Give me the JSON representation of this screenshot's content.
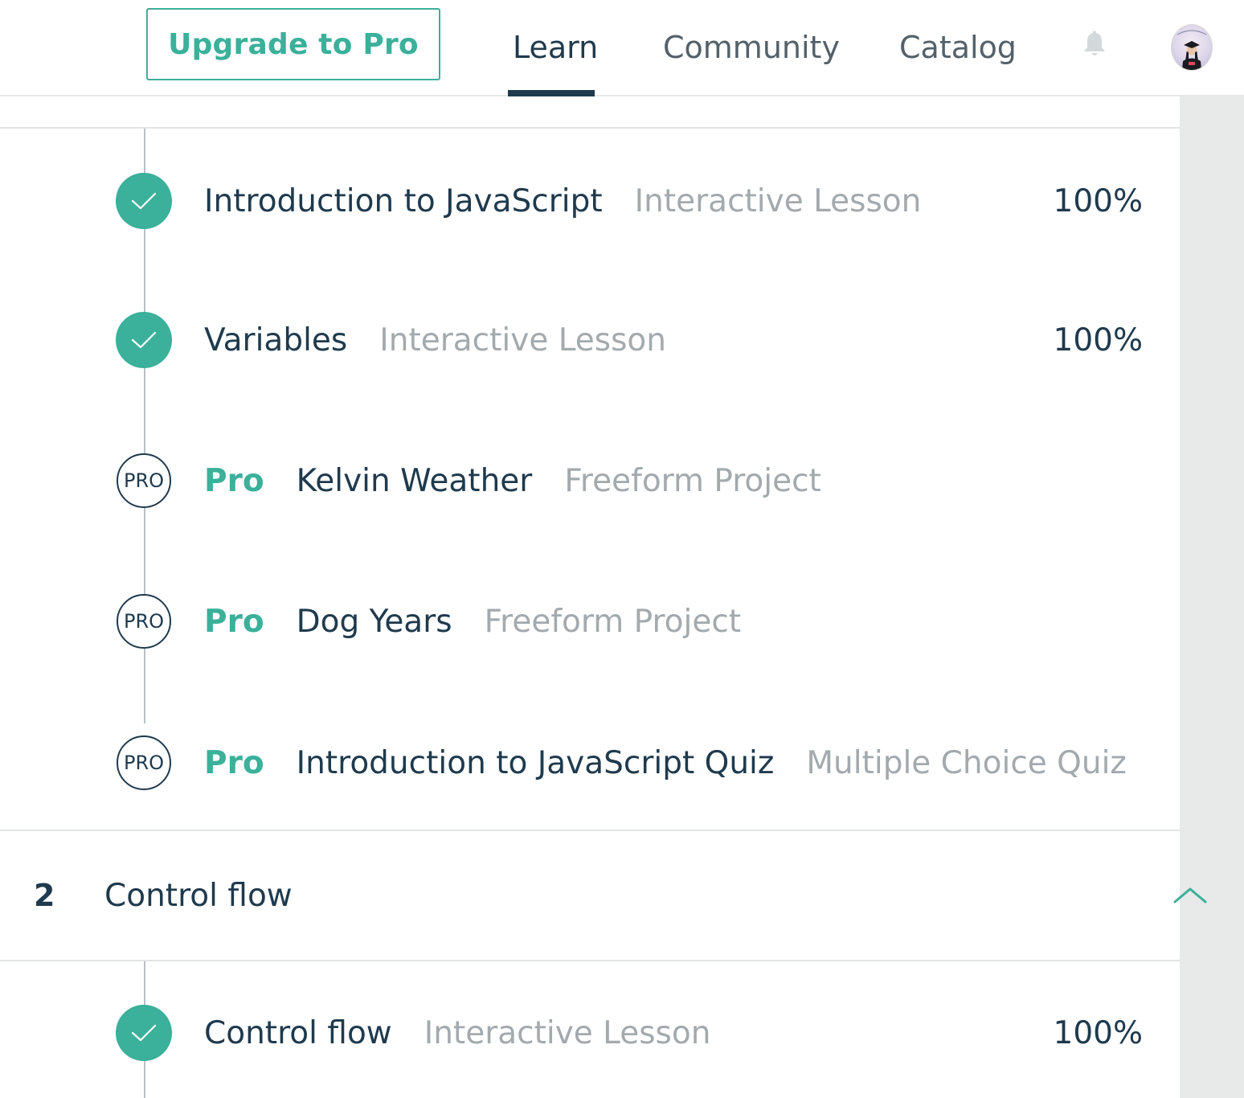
{
  "header": {
    "upgrade_label": "Upgrade to Pro",
    "nav": [
      {
        "label": "Learn",
        "active": true
      },
      {
        "label": "Community",
        "active": false
      },
      {
        "label": "Catalog",
        "active": false
      }
    ],
    "bell_icon": "bell-icon",
    "avatar_icon": "user-avatar"
  },
  "colors": {
    "accent": "#3bb09a",
    "text_dark": "#1f3a4d",
    "text_muted": "#a3aaae",
    "divider": "#e2e5e5",
    "scroll_track": "#e8e9e9"
  },
  "section1": {
    "items": [
      {
        "status": "complete",
        "status_icon": "check-icon",
        "title": "Introduction to JavaScript",
        "type": "Interactive Lesson",
        "progress": "100%"
      },
      {
        "status": "complete",
        "status_icon": "check-icon",
        "title": "Variables",
        "type": "Interactive Lesson",
        "progress": "100%"
      },
      {
        "status": "pro",
        "badge": "PRO",
        "pro_label": "Pro",
        "title": "Kelvin Weather",
        "type": "Freeform Project"
      },
      {
        "status": "pro",
        "badge": "PRO",
        "pro_label": "Pro",
        "title": "Dog Years",
        "type": "Freeform Project"
      },
      {
        "status": "pro",
        "badge": "PRO",
        "pro_label": "Pro",
        "title": "Introduction to JavaScript Quiz",
        "type": "Multiple Choice Quiz"
      }
    ]
  },
  "section2": {
    "number": "2",
    "title": "Control flow",
    "expanded": true,
    "toggle_icon": "chevron-up-icon",
    "items": [
      {
        "status": "complete",
        "status_icon": "check-icon",
        "title": "Control flow",
        "type": "Interactive Lesson",
        "progress": "100%"
      }
    ]
  }
}
